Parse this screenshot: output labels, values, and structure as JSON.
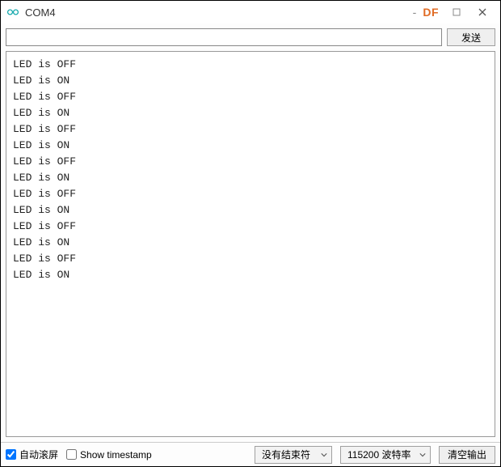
{
  "titlebar": {
    "title": "COM4",
    "brand": "DF",
    "minimize_label": "-",
    "maximize_label": "□",
    "close_label": "×"
  },
  "toolbar": {
    "input_value": "",
    "input_placeholder": "",
    "send_label": "发送"
  },
  "console": {
    "lines": [
      "LED is OFF",
      "LED is ON",
      "LED is OFF",
      "LED is ON",
      "LED is OFF",
      "LED is ON",
      "LED is OFF",
      "LED is ON",
      "LED is OFF",
      "LED is ON",
      "LED is OFF",
      "LED is ON",
      "LED is OFF",
      "LED is ON"
    ]
  },
  "footer": {
    "autoscroll_label": "自动滚屏",
    "autoscroll_checked": true,
    "timestamp_label": "Show timestamp",
    "timestamp_checked": false,
    "line_ending_selected": "没有结束符",
    "baud_selected": "115200 波特率",
    "clear_label": "清空输出"
  }
}
